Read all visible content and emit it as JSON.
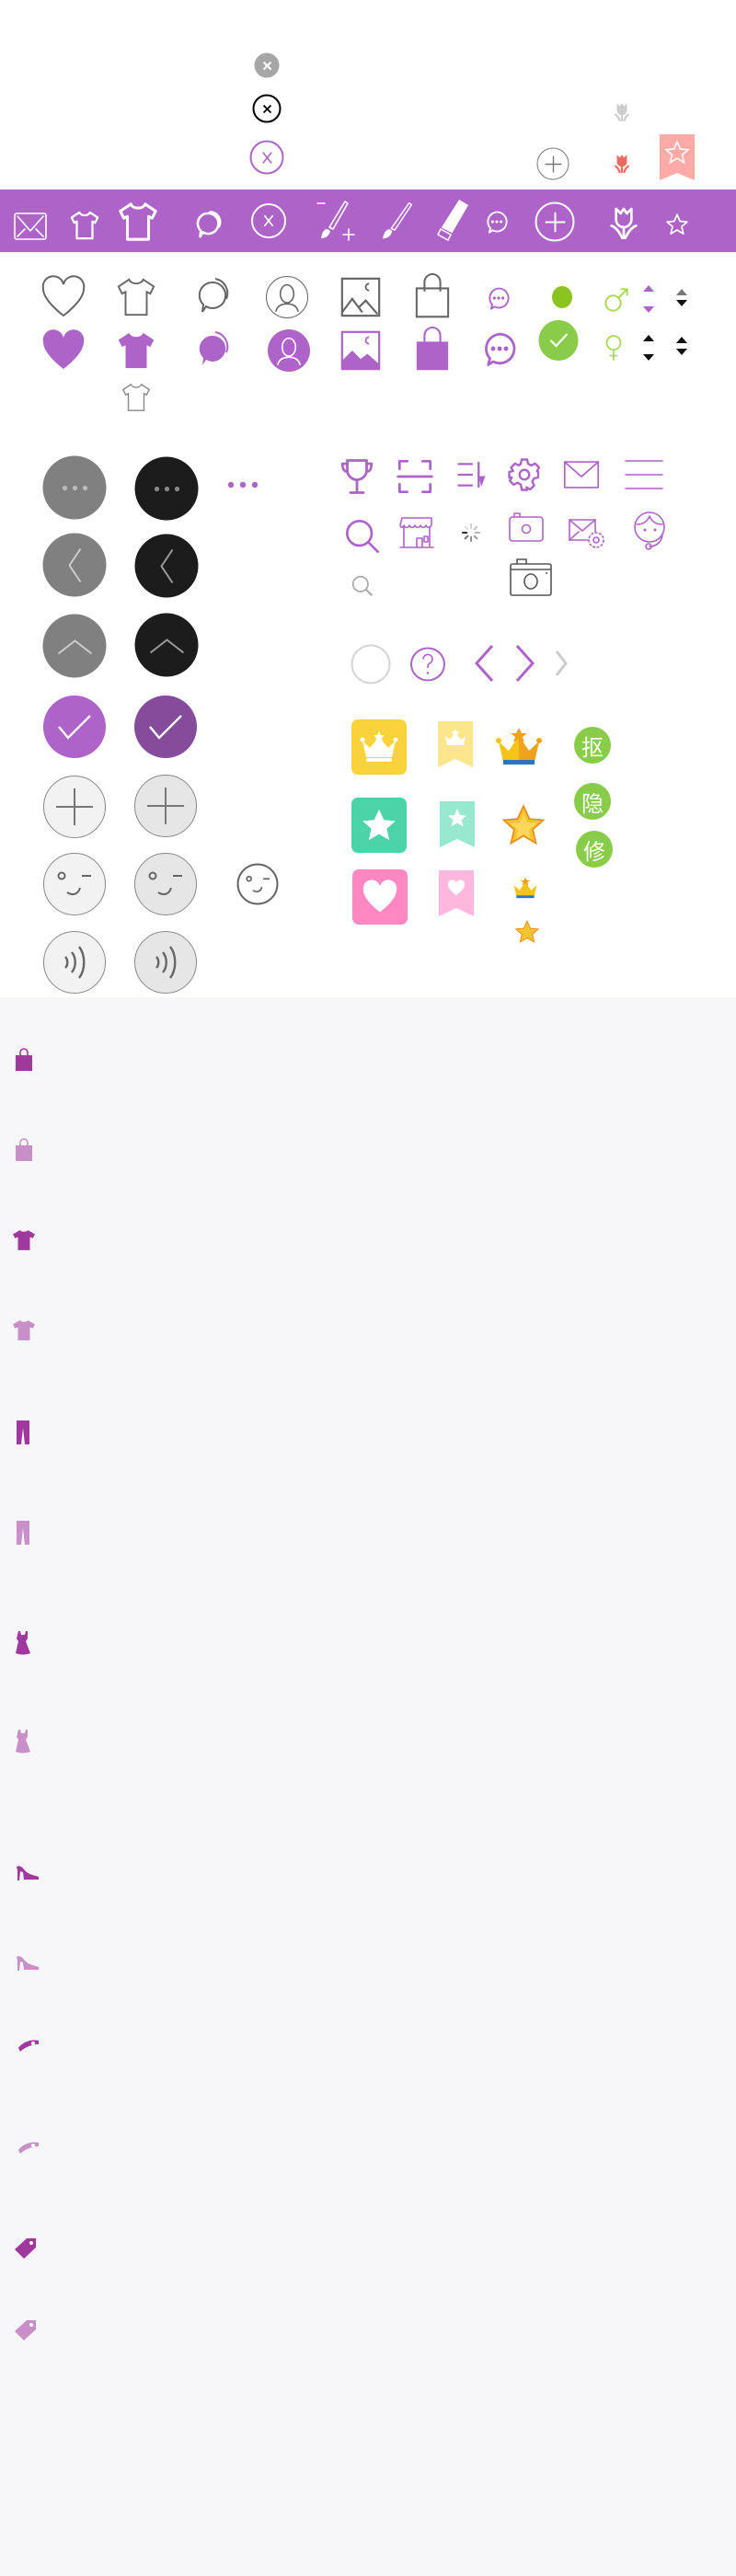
{
  "colors": {
    "purple": "#ae63c9",
    "dark_purple": "#844c9b",
    "green": "#88cc4a",
    "gray": "#808080",
    "black": "#1c1c1c",
    "yellow": "#f8d33c",
    "teal": "#4cd3a7",
    "pink": "#ff87c2"
  },
  "badges": {
    "cutout": "抠",
    "hide": "隐",
    "retouch": "修"
  }
}
